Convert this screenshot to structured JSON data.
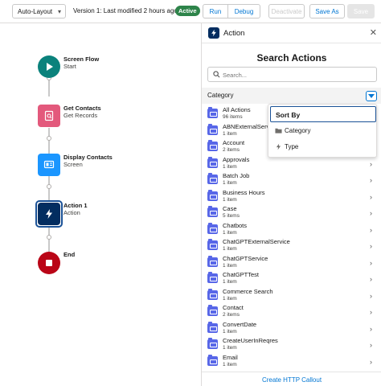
{
  "toolbar": {
    "layout_select": "Auto-Layout",
    "version_text": "Version 1: Last modified 2 hours ago",
    "status_badge": "Active",
    "run_label": "Run",
    "debug_label": "Debug",
    "deactivate_label": "Deactivate",
    "save_as_label": "Save As",
    "save_label": "Save"
  },
  "flow": {
    "nodes": [
      {
        "title": "Screen Flow",
        "subtitle": "Start",
        "icon": "play-icon",
        "color": "#0b827c"
      },
      {
        "title": "Get Contacts",
        "subtitle": "Get Records",
        "icon": "record-lookup-icon",
        "color": "#e3597c"
      },
      {
        "title": "Display Contacts",
        "subtitle": "Screen",
        "icon": "screen-icon",
        "color": "#1b96ff"
      },
      {
        "title": "Action 1",
        "subtitle": "Action",
        "icon": "lightning-icon",
        "color": "#032d60"
      },
      {
        "title": "End",
        "subtitle": "",
        "icon": "stop-icon",
        "color": "#ba0517"
      }
    ]
  },
  "panel": {
    "title": "Action",
    "search_title": "Search Actions",
    "search_placeholder": "Search...",
    "category_label": "Category",
    "items": [
      {
        "name": "All Actions",
        "count": "96 items",
        "chevron": false
      },
      {
        "name": "ABNExternalServic",
        "count": "1 item",
        "chevron": false
      },
      {
        "name": "Account",
        "count": "2 items",
        "chevron": false
      },
      {
        "name": "Approvals",
        "count": "1 item",
        "chevron": true
      },
      {
        "name": "Batch Job",
        "count": "1 item",
        "chevron": true
      },
      {
        "name": "Business Hours",
        "count": "1 item",
        "chevron": true
      },
      {
        "name": "Case",
        "count": "5 items",
        "chevron": true
      },
      {
        "name": "Chatbots",
        "count": "1 item",
        "chevron": true
      },
      {
        "name": "ChatGPTExternalService",
        "count": "1 item",
        "chevron": true
      },
      {
        "name": "ChatGPTService",
        "count": "1 item",
        "chevron": true
      },
      {
        "name": "ChatGPTTest",
        "count": "1 item",
        "chevron": true
      },
      {
        "name": "Commerce Search",
        "count": "1 item",
        "chevron": true
      },
      {
        "name": "Contact",
        "count": "2 items",
        "chevron": true
      },
      {
        "name": "ConvertDate",
        "count": "1 item",
        "chevron": true
      },
      {
        "name": "CreateUserInReqres",
        "count": "1 item",
        "chevron": true
      },
      {
        "name": "Email",
        "count": "1 item",
        "chevron": true
      }
    ],
    "footer_link": "Create HTTP Callout"
  },
  "sort_menu": {
    "header": "Sort By",
    "options": [
      {
        "label": "Category",
        "icon": "folder-icon"
      },
      {
        "label": "Type",
        "icon": "lightning-icon"
      }
    ]
  },
  "colors": {
    "accent": "#0176d3",
    "active_badge": "#2e844a",
    "folder": "#5867e8"
  }
}
